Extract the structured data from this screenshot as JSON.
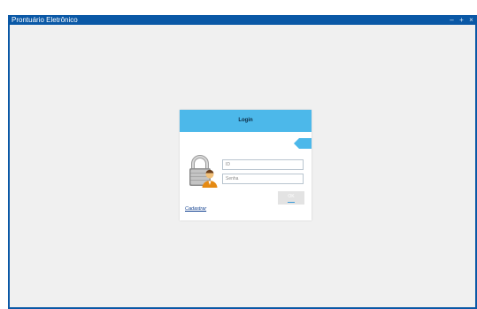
{
  "window": {
    "title": "Prontuário Eletrônico",
    "controls": [
      "minimize-icon",
      "maximize-icon",
      "close-icon"
    ],
    "accent_color": "#0a58a6"
  },
  "login": {
    "title": "Login",
    "header_color": "#4cb8ea",
    "id_placeholder": "ID",
    "password_placeholder": "Senha",
    "id_value": "",
    "password_value": "",
    "ok_label": "OK",
    "register_link": "Cadastrar",
    "icons": [
      "back-arrow-icon",
      "lock-user-icon"
    ]
  }
}
